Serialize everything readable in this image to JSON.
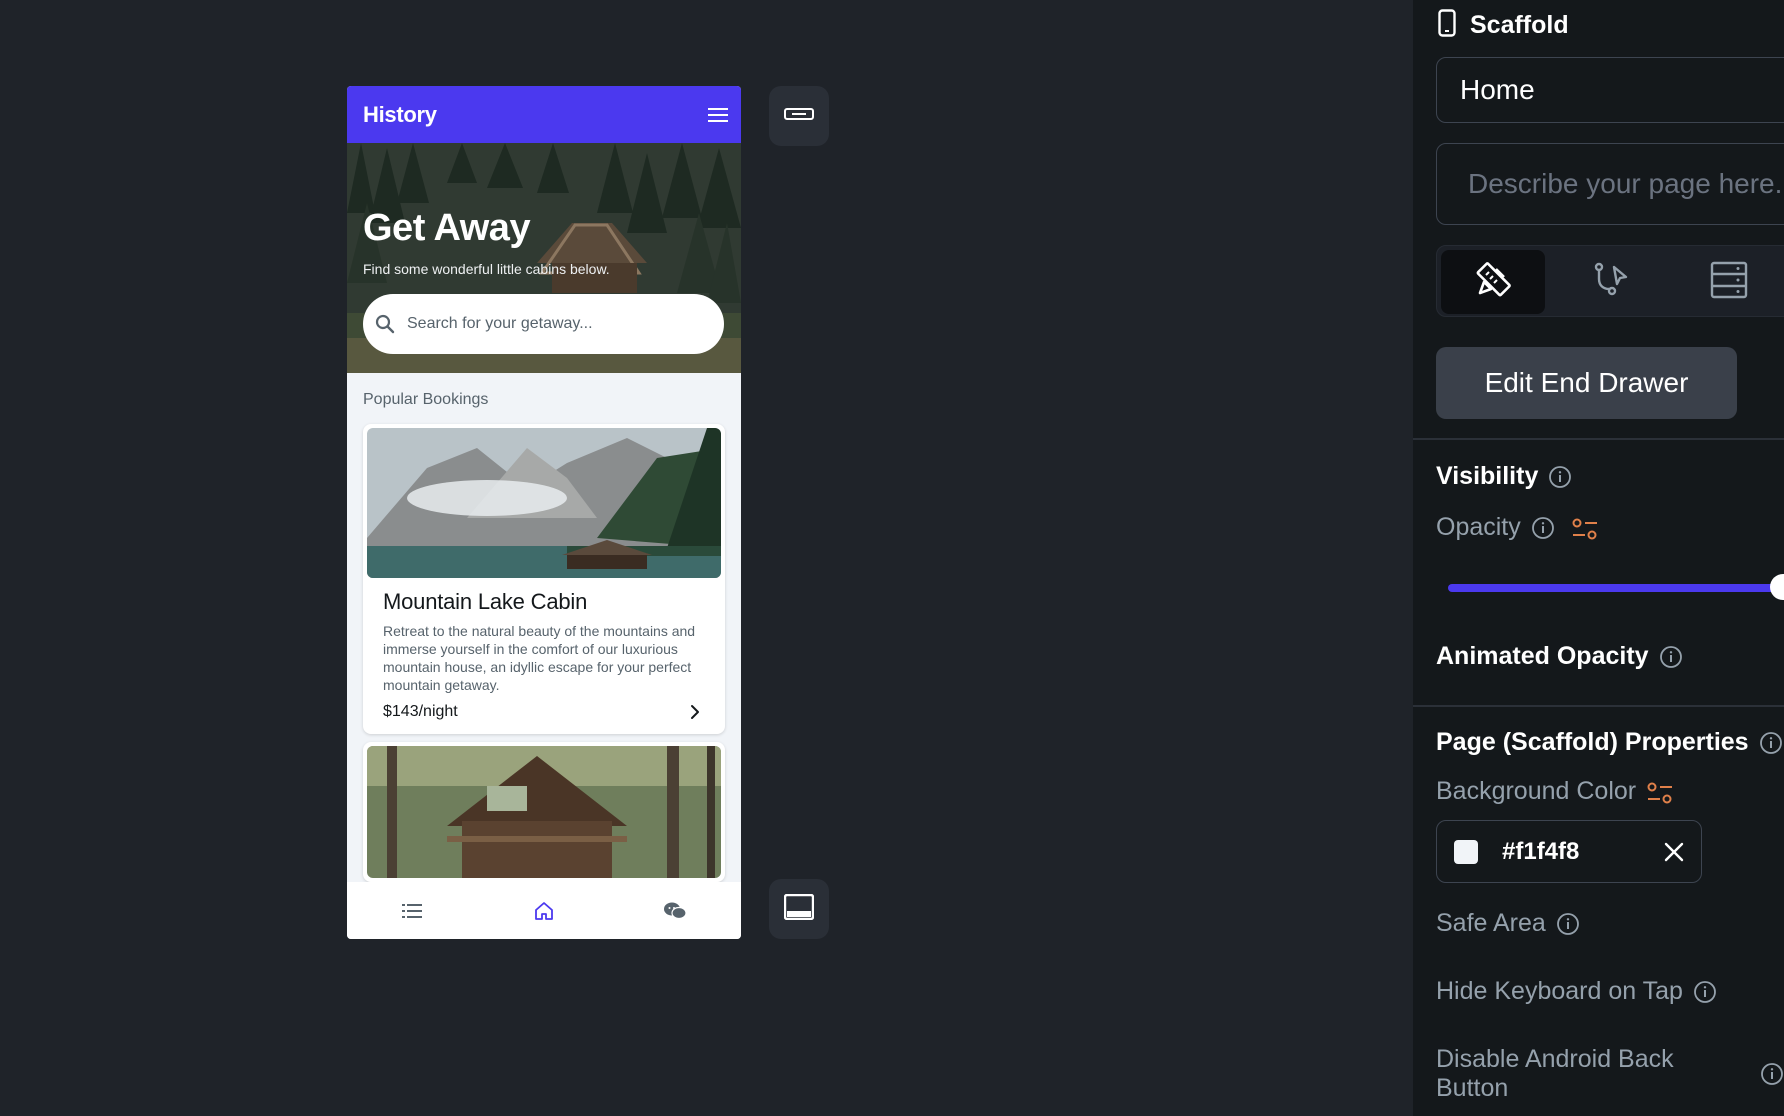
{
  "phone": {
    "appbar": {
      "title": "History",
      "menu_icon": "menu-icon"
    },
    "hero": {
      "title": "Get Away",
      "subtitle": "Find some wonderful little cabins below.",
      "search_placeholder": "Search for your getaway..."
    },
    "section_label": "Popular Bookings",
    "cards": [
      {
        "title": "Mountain Lake Cabin",
        "description": "Retreat to the natural beauty of the mountains and immerse yourself in the comfort of our luxurious mountain house, an idyllic escape for your perfect mountain getaway.",
        "price": "$143/night"
      }
    ],
    "navbar": {
      "items": [
        "list-icon",
        "home-icon",
        "chat-icon"
      ],
      "active_color": "#4b39ef"
    }
  },
  "panel": {
    "header": "Scaffold",
    "page_name": "Home",
    "page_description_placeholder": "Describe your page here...",
    "tabs": [
      "design-tools-icon",
      "actions-icon",
      "backend-query-icon"
    ],
    "edit_end_drawer": "Edit End Drawer",
    "visibility": {
      "title": "Visibility",
      "opacity_label": "Opacity",
      "opacity_value": 1.0
    },
    "animated_opacity": "Animated Opacity",
    "scaffold_props": {
      "title": "Page (Scaffold) Properties",
      "background_color_label": "Background Color",
      "background_color": "#f1f4f8",
      "safe_area": "Safe Area",
      "hide_keyboard": "Hide Keyboard on Tap",
      "disable_back": "Disable Android Back Button"
    }
  },
  "colors": {
    "accent": "#4b39ef",
    "variable_icon": "#e0804a"
  }
}
